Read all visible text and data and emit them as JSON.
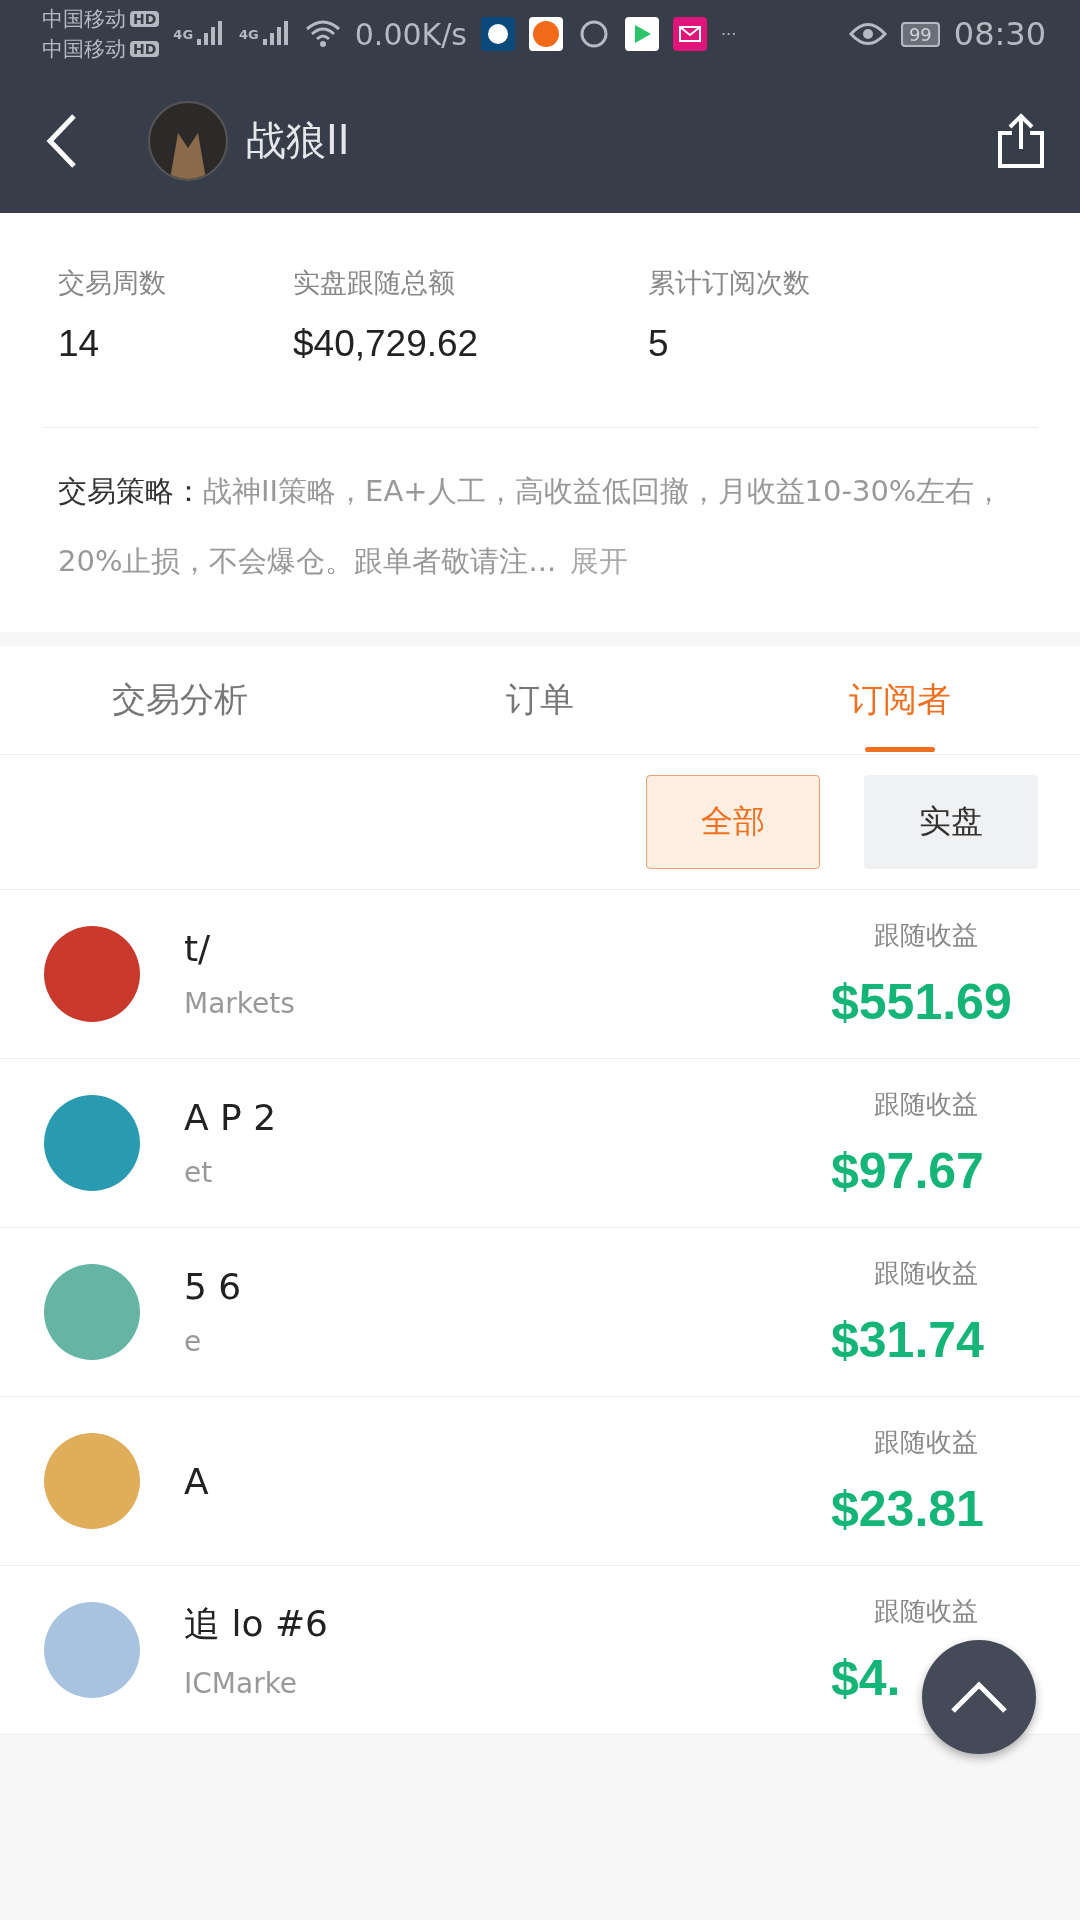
{
  "status_bar": {
    "carriers": [
      "中国移动",
      "中国移动"
    ],
    "hd_badges": [
      "HD",
      "HD"
    ],
    "network_labels": [
      "4G",
      "4G"
    ],
    "speed": "0.00K/s",
    "more": "···",
    "battery": "99",
    "time": "08:30"
  },
  "header": {
    "title": "战狼II"
  },
  "stats": [
    {
      "label": "交易周数",
      "value": "14"
    },
    {
      "label": "实盘跟随总额",
      "value": "$40,729.62"
    },
    {
      "label": "累计订阅次数",
      "value": "5"
    }
  ],
  "strategy": {
    "label": "交易策略：",
    "text": "战神II策略，EA+人工，高收益低回撤，月收益10-30%左右，20%止损，不会爆仓。跟单者敬请注...",
    "expand": "展开"
  },
  "tabs": [
    {
      "label": "交易分析",
      "selected": false
    },
    {
      "label": "订单",
      "selected": false
    },
    {
      "label": "订阅者",
      "selected": true
    }
  ],
  "filters": [
    {
      "label": "全部",
      "selected": true
    },
    {
      "label": "实盘",
      "selected": false
    }
  ],
  "subscribers": [
    {
      "color": "#c8392b",
      "name": "t/",
      "broker": "Markets",
      "profit_label": "跟随收益",
      "profit": "$551.69"
    },
    {
      "color": "#2a9ab0",
      "name": "A P 2",
      "broker": "et",
      "profit_label": "跟随收益",
      "profit": "$97.67"
    },
    {
      "color": "#64b5a3",
      "name": "5 6",
      "broker": "e",
      "profit_label": "跟随收益",
      "profit": "$31.74"
    },
    {
      "color": "#e0ad5a",
      "name": "A",
      "profit_label": "跟随收益",
      "profit": "$23.81"
    },
    {
      "color": "#a8c3e0",
      "name": "追 lo #6",
      "broker": "ICMarke",
      "profit_label": "跟随收益",
      "profit": "$4."
    }
  ]
}
